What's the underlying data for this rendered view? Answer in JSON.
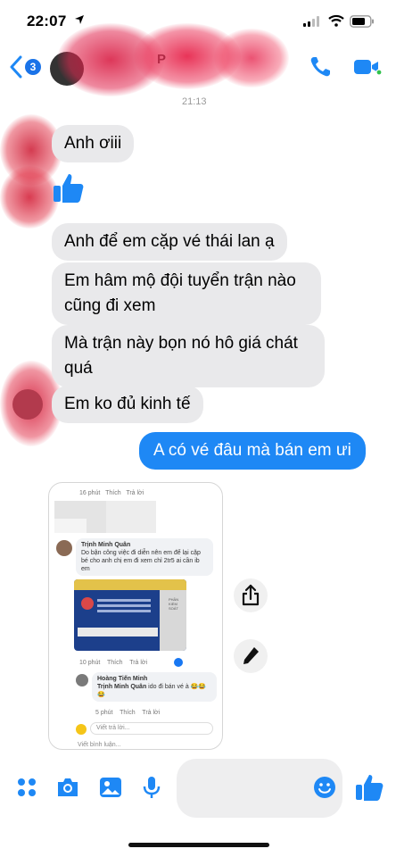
{
  "status_bar": {
    "time": "22:07"
  },
  "header": {
    "unread_count": "3",
    "contact_name": "P",
    "time_label": "21:13"
  },
  "messages": [
    {
      "text": "Anh ơiii",
      "direction": "incoming"
    },
    {
      "text": "Anh để em cặp vé thái lan ạ",
      "direction": "incoming"
    },
    {
      "text": "Em hâm mộ đội tuyển trận nào cũng đi xem",
      "direction": "incoming"
    },
    {
      "text": "Mà trận này bọn nó hô giá chát quá",
      "direction": "incoming"
    },
    {
      "text": "Em ko đủ kinh tế",
      "direction": "incoming"
    },
    {
      "text": "A có vé đâu mà bán em ưi",
      "direction": "outgoing"
    }
  ],
  "shared_screenshot": {
    "top_meta": {
      "time": "16 phút",
      "like": "Thích",
      "reply": "Trả lời"
    },
    "comment1": {
      "author": "Trịnh Minh Quân",
      "text": "Do bận công việc đi diễn nên em để lại cặp bé cho anh chị em đi xem chỉ 2tr5 ai cần ib em",
      "meta_time": "10 phút",
      "meta_like": "Thích",
      "meta_reply": "Trả lời",
      "ticket_stub_text": "PHẦN KIỂM SOÁT"
    },
    "comment2": {
      "author": "Hoàng Tiến Minh",
      "mention": "Trịnh Minh Quân",
      "text": "ido đi bán vé à 😂😂",
      "extra": "😂",
      "meta_time": "5 phút",
      "meta_like": "Thích",
      "meta_reply": "Trả lời"
    },
    "reply_placeholder": "Viết trả lời...",
    "comment_placeholder": "Viết bình luận..."
  },
  "composer": {
    "placeholder": ""
  },
  "colors": {
    "accent": "#1e88f5",
    "incoming_bubble": "#e9e9eb",
    "online_dot": "#31c24d"
  },
  "icons": [
    "location-arrow-icon",
    "signal-icon",
    "wifi-icon",
    "battery-icon",
    "back-chevron-icon",
    "phone-icon",
    "video-camera-icon",
    "thumbs-up-icon",
    "share-icon",
    "pencil-icon",
    "apps-icon",
    "camera-icon",
    "image-icon",
    "microphone-icon",
    "emoji-icon"
  ]
}
